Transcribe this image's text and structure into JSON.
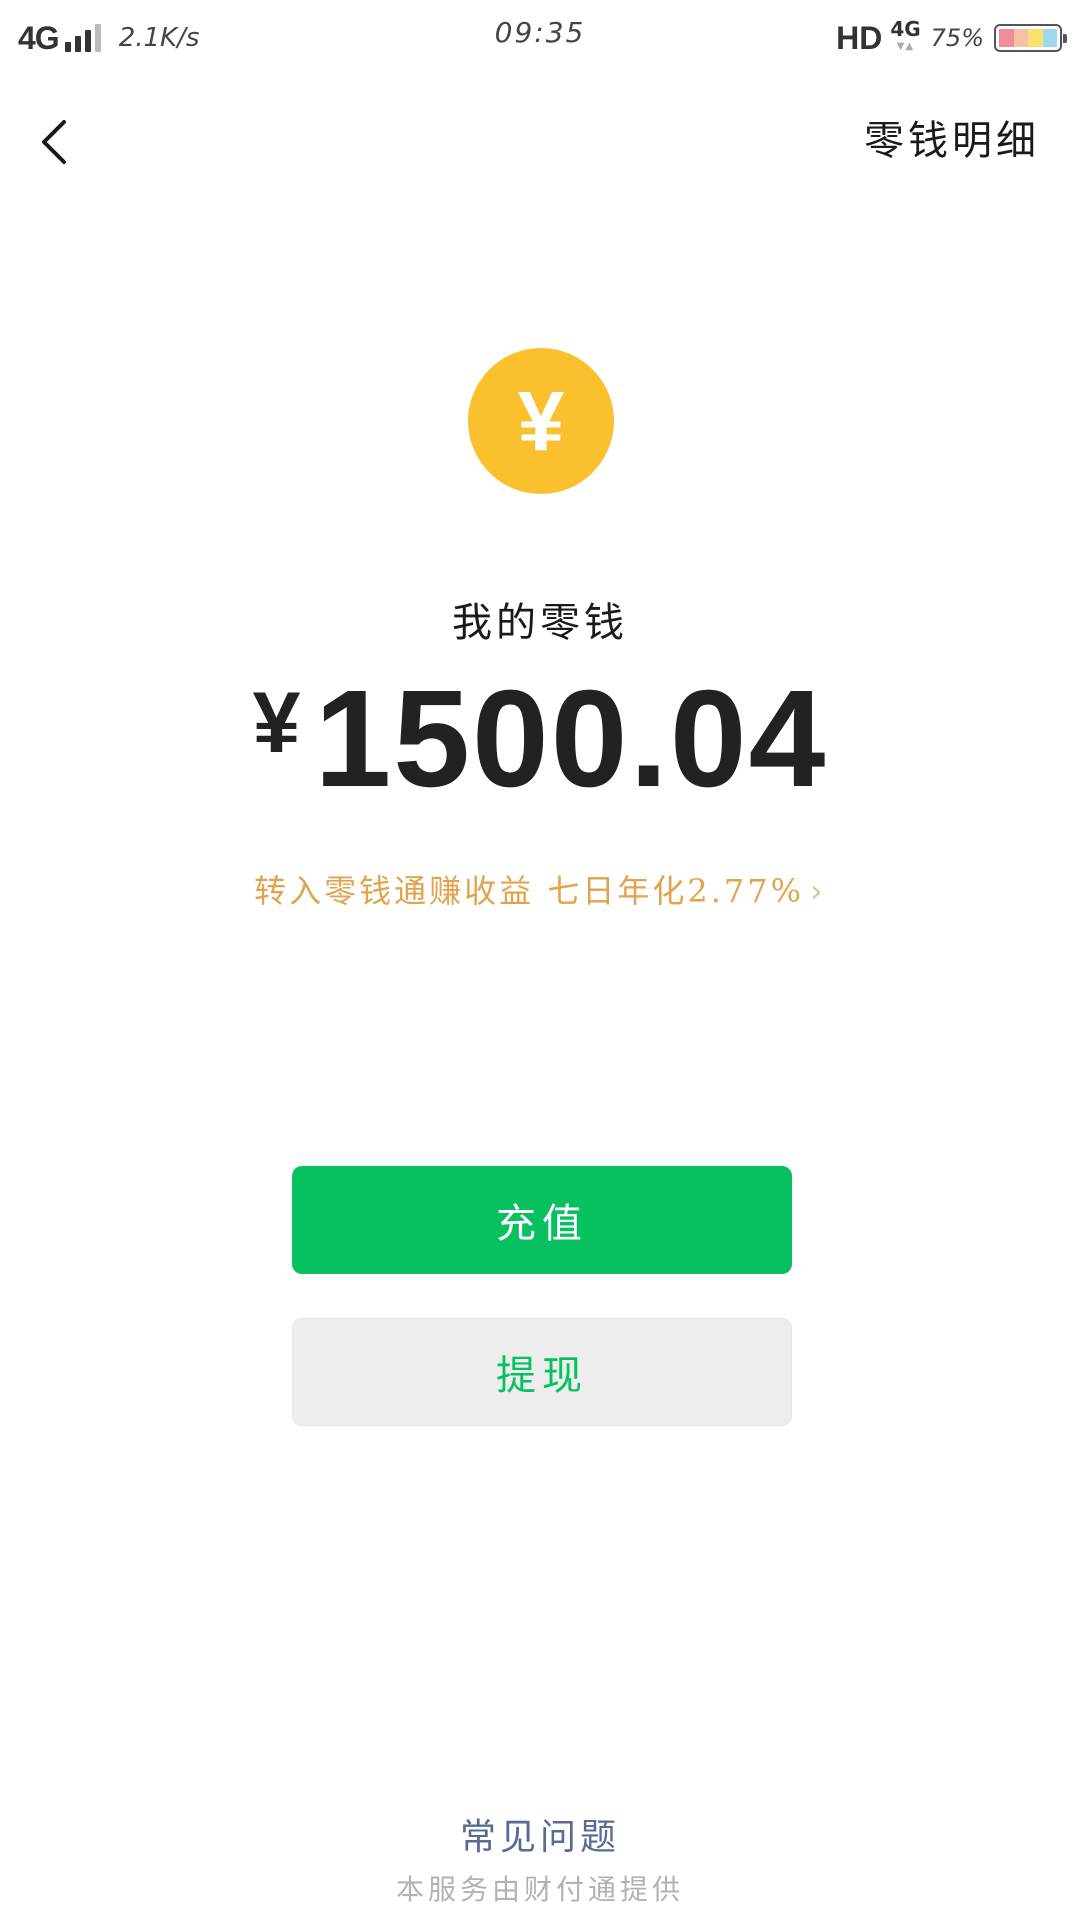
{
  "status_bar": {
    "network": "4G",
    "speed": "2.1K/s",
    "time": "09:35",
    "hd": "HD",
    "network2": "4G",
    "battery": "75%"
  },
  "header": {
    "back_icon": "chevron-left-icon",
    "link_label": "零钱明细"
  },
  "balance_card": {
    "coin_icon": "yen-coin-icon",
    "coin_glyph": "¥",
    "label": "我的零钱",
    "currency": "¥",
    "amount": "1500.04",
    "promo_text": "转入零钱通赚收益 七日年化2.77%",
    "promo_chevron": "›"
  },
  "actions": {
    "topup_label": "充值",
    "withdraw_label": "提现"
  },
  "footer": {
    "faq_label": "常见问题",
    "provider_text": "本服务由财付通提供"
  },
  "colors": {
    "primary_green": "#07c160",
    "coin_yellow": "#fbc02d",
    "promo_orange": "#e1a34d",
    "link_blue": "#576b95",
    "secondary_button_bg": "#ededed",
    "footer_gray": "#b2b2b2"
  }
}
